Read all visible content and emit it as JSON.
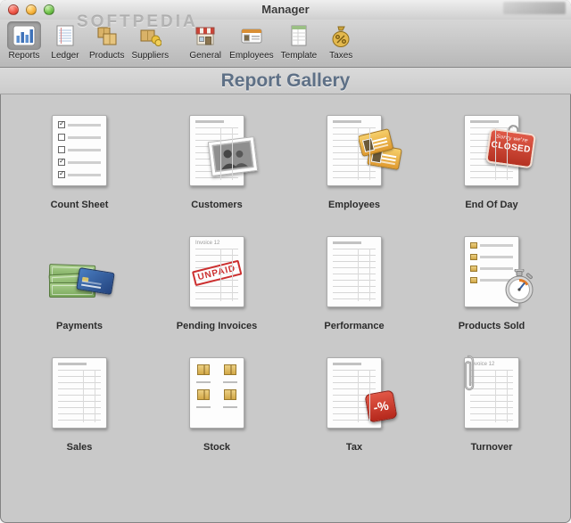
{
  "window": {
    "title": "Manager"
  },
  "watermark": "SOFTPEDIA",
  "toolbar": {
    "selected": "Reports",
    "items": [
      {
        "label": "Reports"
      },
      {
        "label": "Ledger"
      },
      {
        "label": "Products"
      },
      {
        "label": "Suppliers"
      },
      {
        "label": "General"
      },
      {
        "label": "Employees"
      },
      {
        "label": "Template"
      },
      {
        "label": "Taxes"
      }
    ]
  },
  "header": {
    "title": "Report Gallery"
  },
  "gallery": {
    "items": [
      {
        "label": "Count Sheet"
      },
      {
        "label": "Customers"
      },
      {
        "label": "Employees"
      },
      {
        "label": "End Of Day",
        "overlay": {
          "sign_top": "Sorry we're",
          "sign_main": "CLOSED"
        }
      },
      {
        "label": "Payments"
      },
      {
        "label": "Pending Invoices",
        "overlay": {
          "doc_title": "Invoice 12",
          "stamp": "UNPAID"
        }
      },
      {
        "label": "Performance"
      },
      {
        "label": "Products Sold"
      },
      {
        "label": "Sales"
      },
      {
        "label": "Stock"
      },
      {
        "label": "Tax",
        "overlay": {
          "tag": "-%"
        }
      },
      {
        "label": "Turnover",
        "overlay": {
          "doc_title": "Invoice 12"
        }
      }
    ]
  },
  "colors": {
    "header_text": "#5e7086",
    "closed_sign_red": "#c8402f",
    "stamp_red": "#cc2f2f",
    "money_green": "#79a75b",
    "card_blue": "#2f5496",
    "box_gold": "#d2a847",
    "selection_gray": "#8e8e8e"
  }
}
